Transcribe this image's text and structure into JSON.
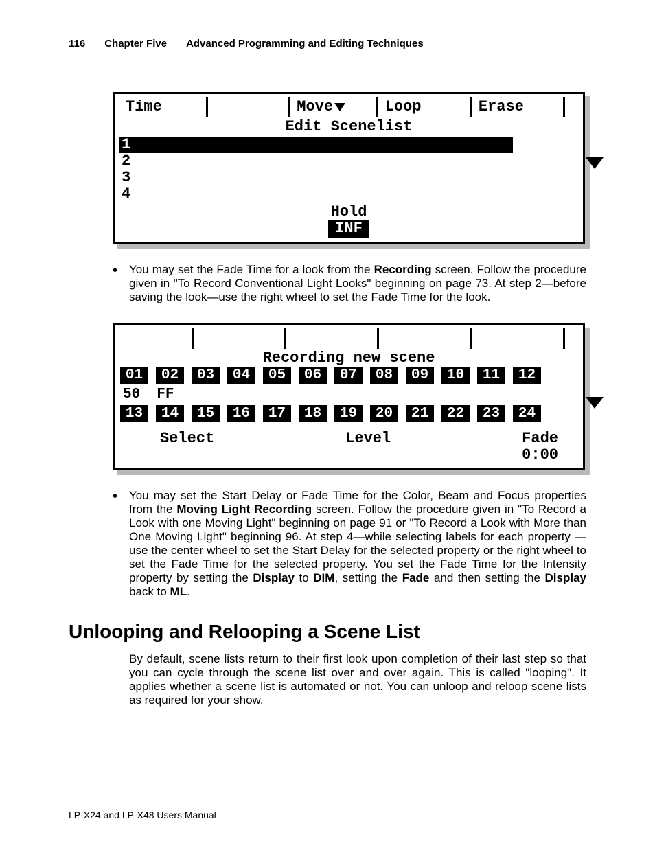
{
  "header": {
    "page_number": "116",
    "chapter": "Chapter Five",
    "title": "Advanced Programming and Editing Techniques"
  },
  "lcd1": {
    "top": {
      "c0": "Time",
      "c2": "Move",
      "c3": "Loop",
      "c4": "Erase"
    },
    "subtitle": "Edit Scenelist",
    "rows": [
      "1",
      "2",
      "3",
      "4"
    ],
    "hold_label": "Hold",
    "hold_value": "INF"
  },
  "bullet1": {
    "pre": "You may set the Fade Time for a look from the ",
    "b1": "Recording",
    "post": " screen. Follow the procedure given in \"To Record Conventional Light Looks\" beginning on page 73. At step 2—before saving the look—use the right wheel to set the Fade Time for the look."
  },
  "lcd2": {
    "subtitle": "Recording new scene",
    "row1": [
      "01",
      "02",
      "03",
      "04",
      "05",
      "06",
      "07",
      "08",
      "09",
      "10",
      "11",
      "12"
    ],
    "encoders": [
      "50",
      "FF"
    ],
    "row2": [
      "13",
      "14",
      "15",
      "16",
      "17",
      "18",
      "19",
      "20",
      "21",
      "22",
      "23",
      "24"
    ],
    "select": "Select",
    "level": "Level",
    "fade_label": "Fade",
    "fade_value": "0:00"
  },
  "bullet2": {
    "t0": "You may set the Start Delay or Fade Time for the Color, Beam and Focus properties from the ",
    "b1": "Moving Light Recording",
    "t1": " screen. Follow the procedure given in \"To Record a Look with one Moving Light\" beginning on page 91 or \"To Record a Look with More than One Moving Light\" beginning 96. At step 4—while selecting labels for each property —use the center wheel to set the Start Delay for the selected property or the right wheel to set the Fade Time for the selected property. You set the Fade Time for the Intensity property by setting the ",
    "b2": "Display",
    "t2": " to ",
    "b3": "DIM",
    "t3": ", setting the ",
    "b4": "Fade",
    "t4": " and then setting the ",
    "b5": "Display",
    "t5": " back to ",
    "b6": "ML",
    "t6": "."
  },
  "section_heading": "Unlooping and Relooping a Scene List",
  "section_para": "By default, scene lists return to their first look upon completion of their last step so that you can cycle through the scene list over and over again. This is called \"looping\". It applies whether a scene list is automated or not. You can unloop and reloop scene lists as required for your show.",
  "footer": "LP-X24 and LP-X48 Users Manual"
}
